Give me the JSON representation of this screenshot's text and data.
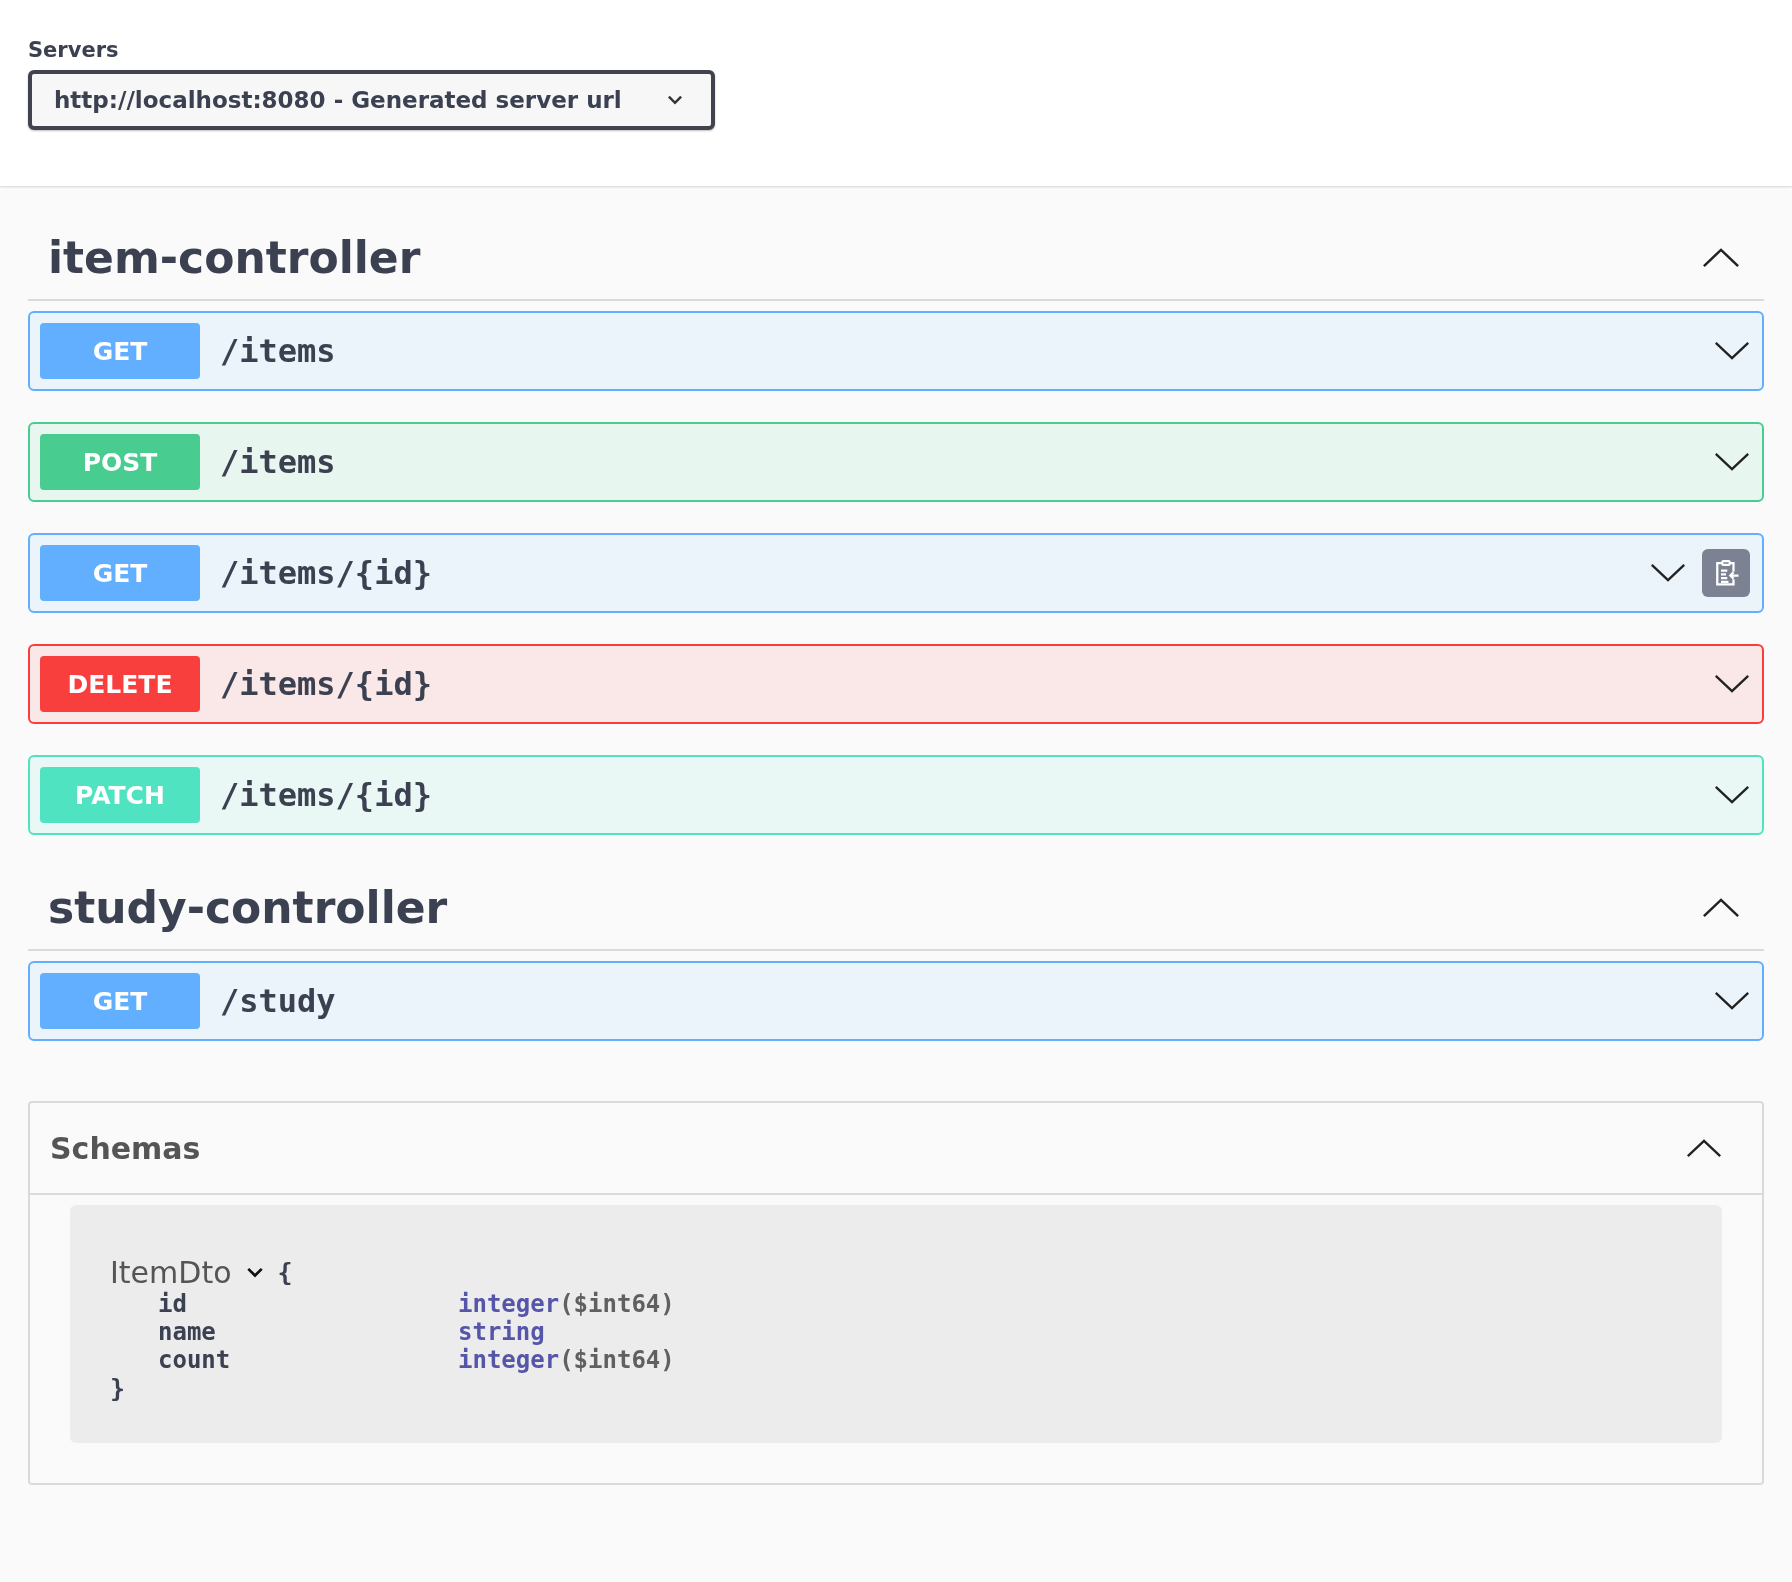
{
  "servers": {
    "label": "Servers",
    "value": "http://localhost:8080 - Generated server url"
  },
  "tags": [
    {
      "name": "item-controller",
      "expanded": true,
      "operations": [
        {
          "method": "GET",
          "path": "/items",
          "expanded": false,
          "copy_button": false
        },
        {
          "method": "POST",
          "path": "/items",
          "expanded": false,
          "copy_button": false
        },
        {
          "method": "GET",
          "path": "/items/{id}",
          "expanded": false,
          "copy_button": true
        },
        {
          "method": "DELETE",
          "path": "/items/{id}",
          "expanded": false,
          "copy_button": false
        },
        {
          "method": "PATCH",
          "path": "/items/{id}",
          "expanded": false,
          "copy_button": false
        }
      ]
    },
    {
      "name": "study-controller",
      "expanded": true,
      "operations": [
        {
          "method": "GET",
          "path": "/study",
          "expanded": false,
          "copy_button": false
        }
      ]
    }
  ],
  "schemas": {
    "title": "Schemas",
    "expanded": true,
    "models": [
      {
        "name": "ItemDto",
        "expanded": true,
        "open_brace": "{",
        "close_brace": "}",
        "properties": [
          {
            "name": "id",
            "type": "integer",
            "format": "($int64)"
          },
          {
            "name": "name",
            "type": "string"
          },
          {
            "name": "count",
            "type": "integer",
            "format": "($int64)"
          }
        ]
      }
    ]
  }
}
